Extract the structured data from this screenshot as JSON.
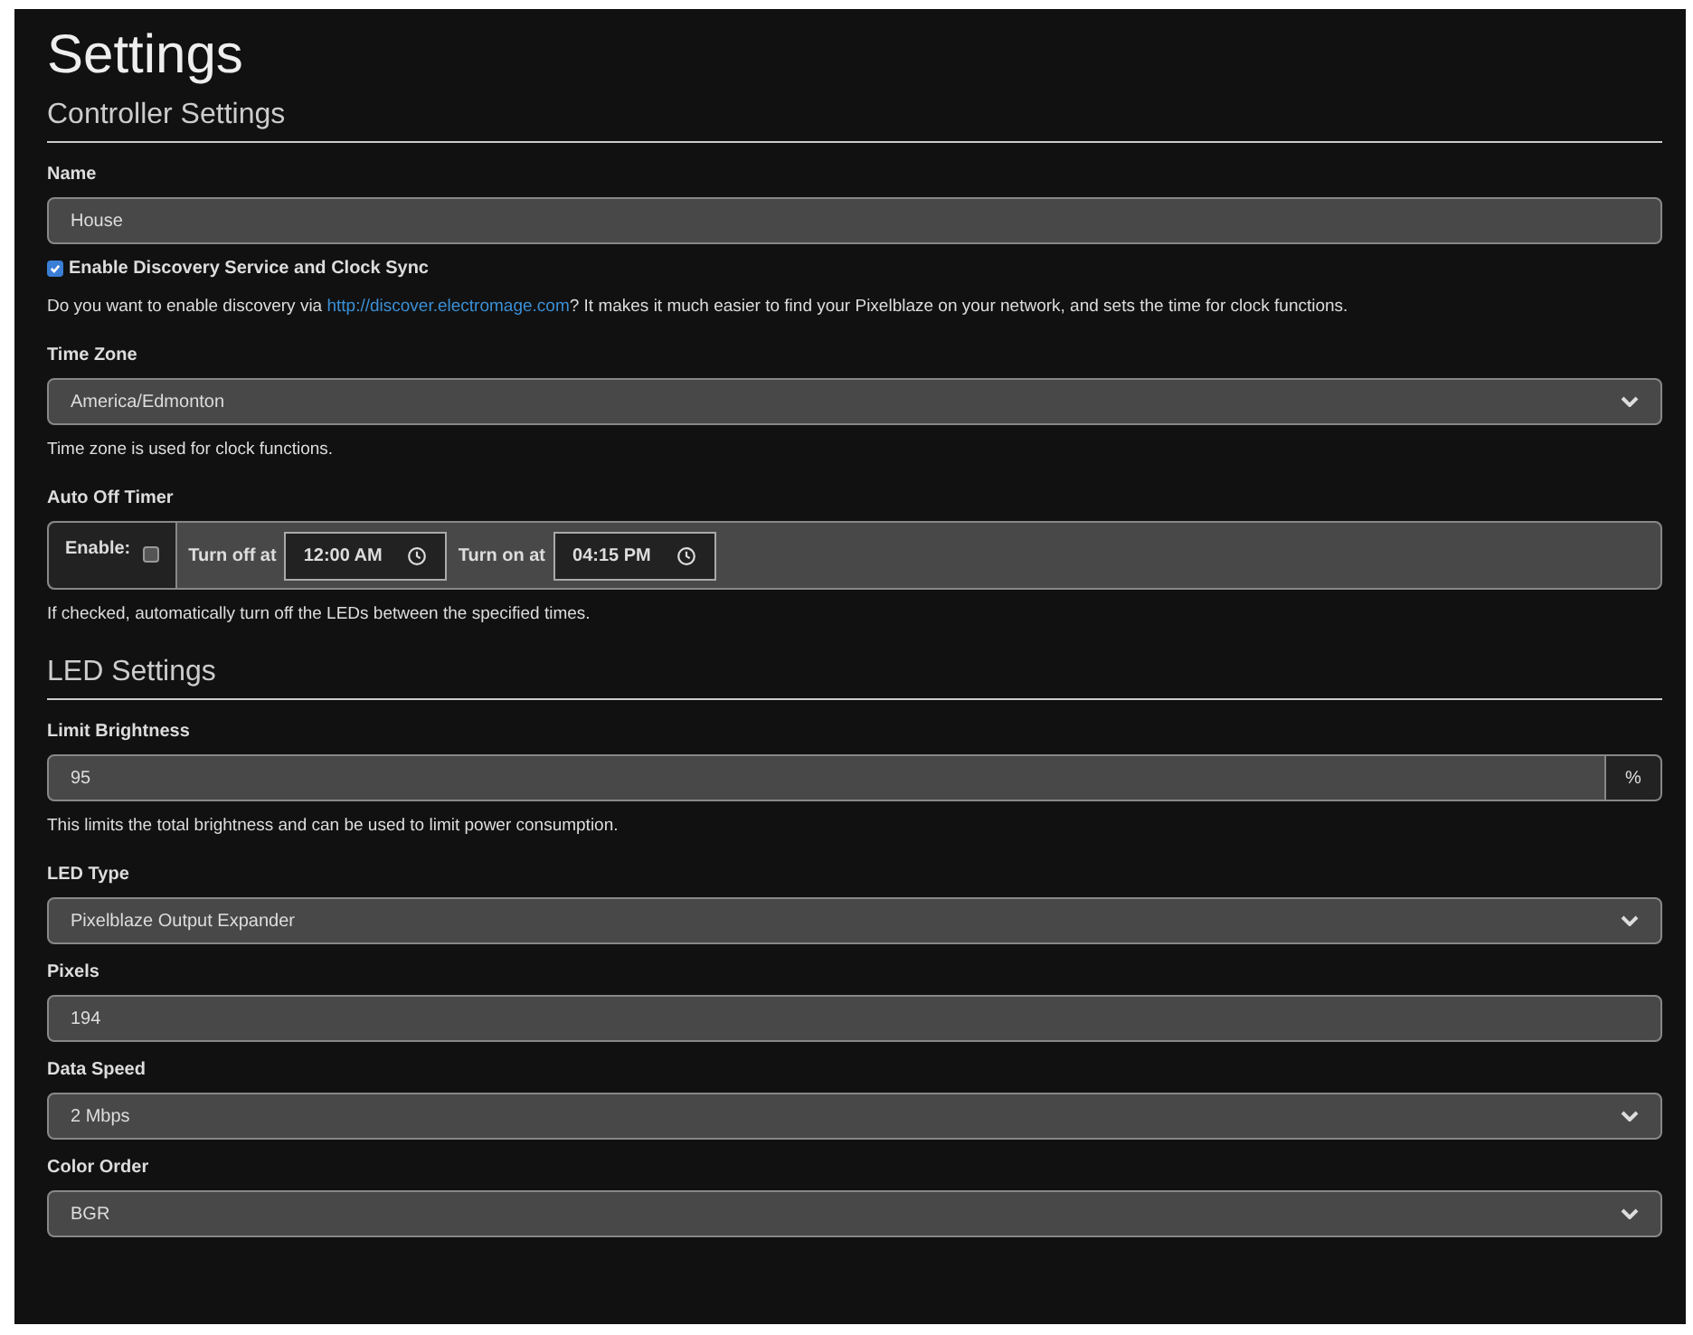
{
  "title": "Settings",
  "sections": [
    {
      "heading": "Controller Settings",
      "fields": [
        {
          "kind": "text",
          "label": "Name",
          "value": "House"
        },
        {
          "kind": "checkbox",
          "label": "Enable Discovery Service and Clock Sync",
          "checked": true,
          "help_before": "Do you want to enable discovery via ",
          "link": "http://discover.electromage.com",
          "help_after": "? It makes it much easier to find your Pixelblaze on your network, and sets the time for clock functions."
        },
        {
          "kind": "select",
          "label": "Time Zone",
          "value": "America/Edmonton",
          "help": "Time zone is used for clock functions."
        },
        {
          "kind": "timer",
          "label": "Auto Off Timer",
          "enable_label": "Enable:",
          "checked": false,
          "off_label": "Turn off at",
          "off_time": "12:00 AM",
          "on_label": "Turn on at",
          "on_time": "04:15 PM",
          "help": "If checked, automatically turn off the LEDs between the specified times."
        }
      ]
    },
    {
      "heading": "LED Settings",
      "fields": [
        {
          "kind": "suffix",
          "label": "Limit Brightness",
          "value": "95",
          "suffix": "%",
          "help": "This limits the total brightness and can be used to limit power consumption."
        },
        {
          "kind": "select",
          "label": "LED Type",
          "value": "Pixelblaze Output Expander"
        },
        {
          "kind": "text",
          "label": "Pixels",
          "value": "194"
        },
        {
          "kind": "select",
          "label": "Data Speed",
          "value": "2 Mbps"
        },
        {
          "kind": "select",
          "label": "Color Order",
          "value": "BGR"
        }
      ]
    }
  ]
}
